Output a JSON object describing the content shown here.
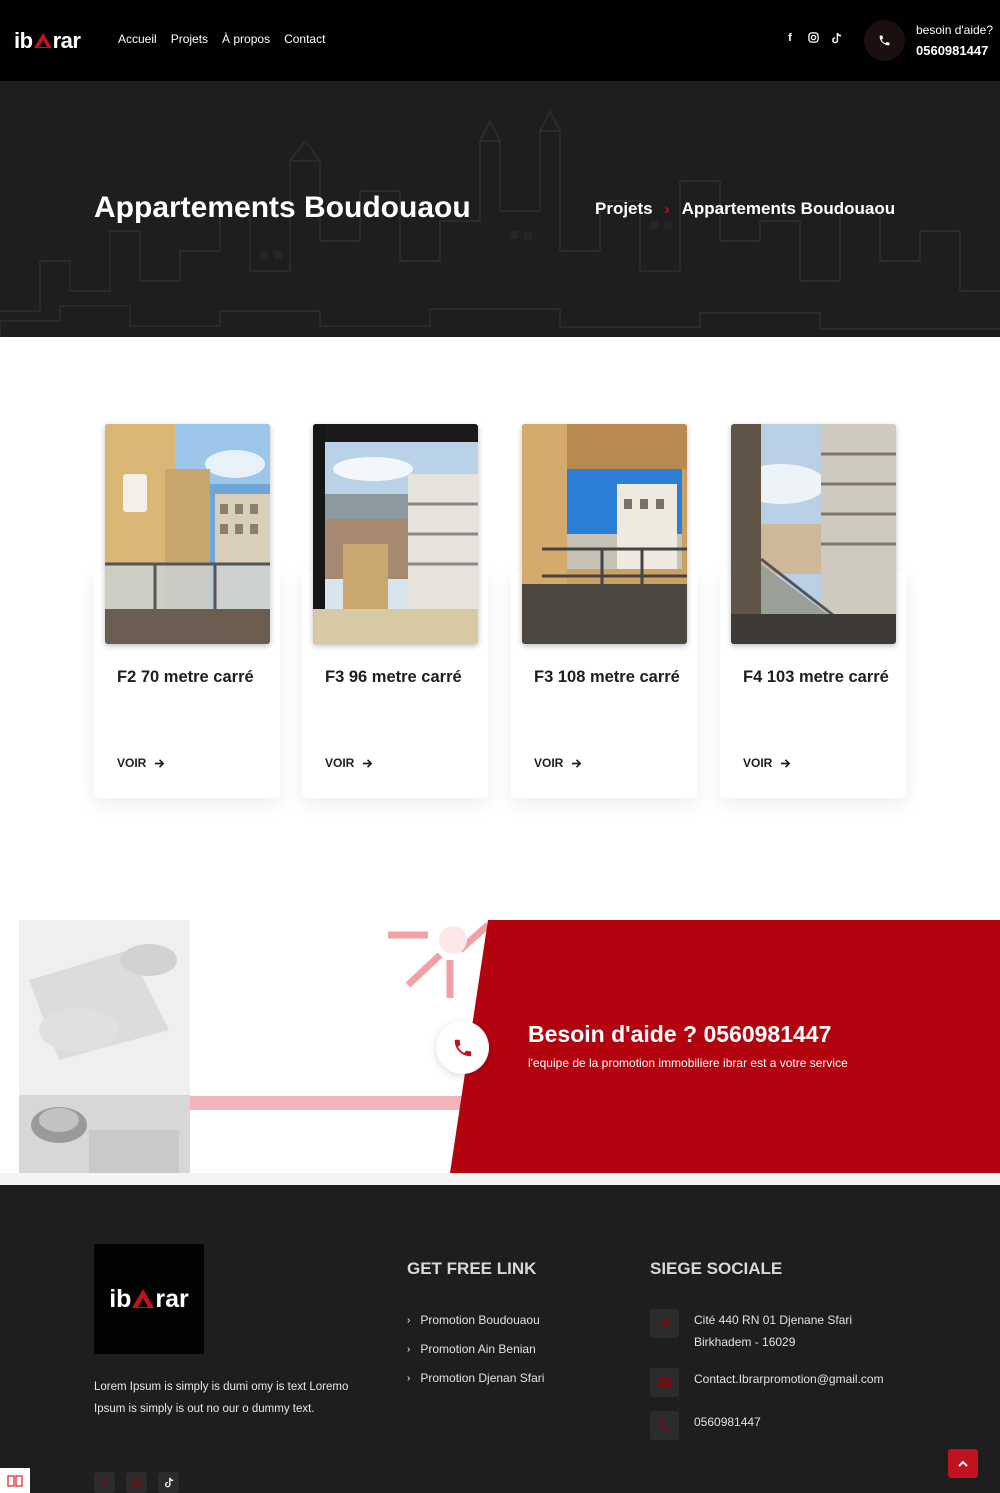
{
  "header": {
    "logo_left": "ib",
    "logo_right": "rar",
    "nav": [
      "Accueil",
      "Projets",
      "À propos",
      "Contact"
    ],
    "socials": [
      "facebook-icon",
      "instagram-icon",
      "tiktok-icon"
    ],
    "help_label": "besoin d'aide?",
    "help_phone": "0560981447"
  },
  "hero": {
    "title": "Appartements Boudouaou",
    "breadcrumb": [
      "Projets",
      "Appartements Boudouaou"
    ]
  },
  "cards": [
    {
      "title": "F2 70 metre carré",
      "link": "VOIR"
    },
    {
      "title": "F3 96 metre carré",
      "link": "VOIR"
    },
    {
      "title": "F3 108 metre carré",
      "link": "VOIR"
    },
    {
      "title": "F4 103 metre carré",
      "link": "VOIR"
    }
  ],
  "cta": {
    "title": "Besoin d'aide ? 0560981447",
    "subtitle": "l'equipe de la promotion immobiliere ibrar est a votre service"
  },
  "footer": {
    "logo_left": "ib",
    "logo_right": "rar",
    "description": "Lorem Ipsum is simply is dumi omy is text Loremo Ipsum is simply is out no our o dummy text.",
    "links_heading": "GET FREE LINK",
    "links": [
      "Promotion Boudouaou",
      "Promotion Ain Benian",
      "Promotion Djenan Sfari"
    ],
    "office_heading": "SIEGE SOCIALE",
    "address_line1": "Cité 440 RN 01 Djenane Sfari",
    "address_line2": "Birkhadem - 16029",
    "email": "Contact.Ibrarpromotion@gmail.com",
    "phone": "0560981447"
  },
  "colors": {
    "accent": "#c1121f",
    "cta_red": "#b3030f",
    "dark": "#1e1e20",
    "header": "#010101"
  }
}
